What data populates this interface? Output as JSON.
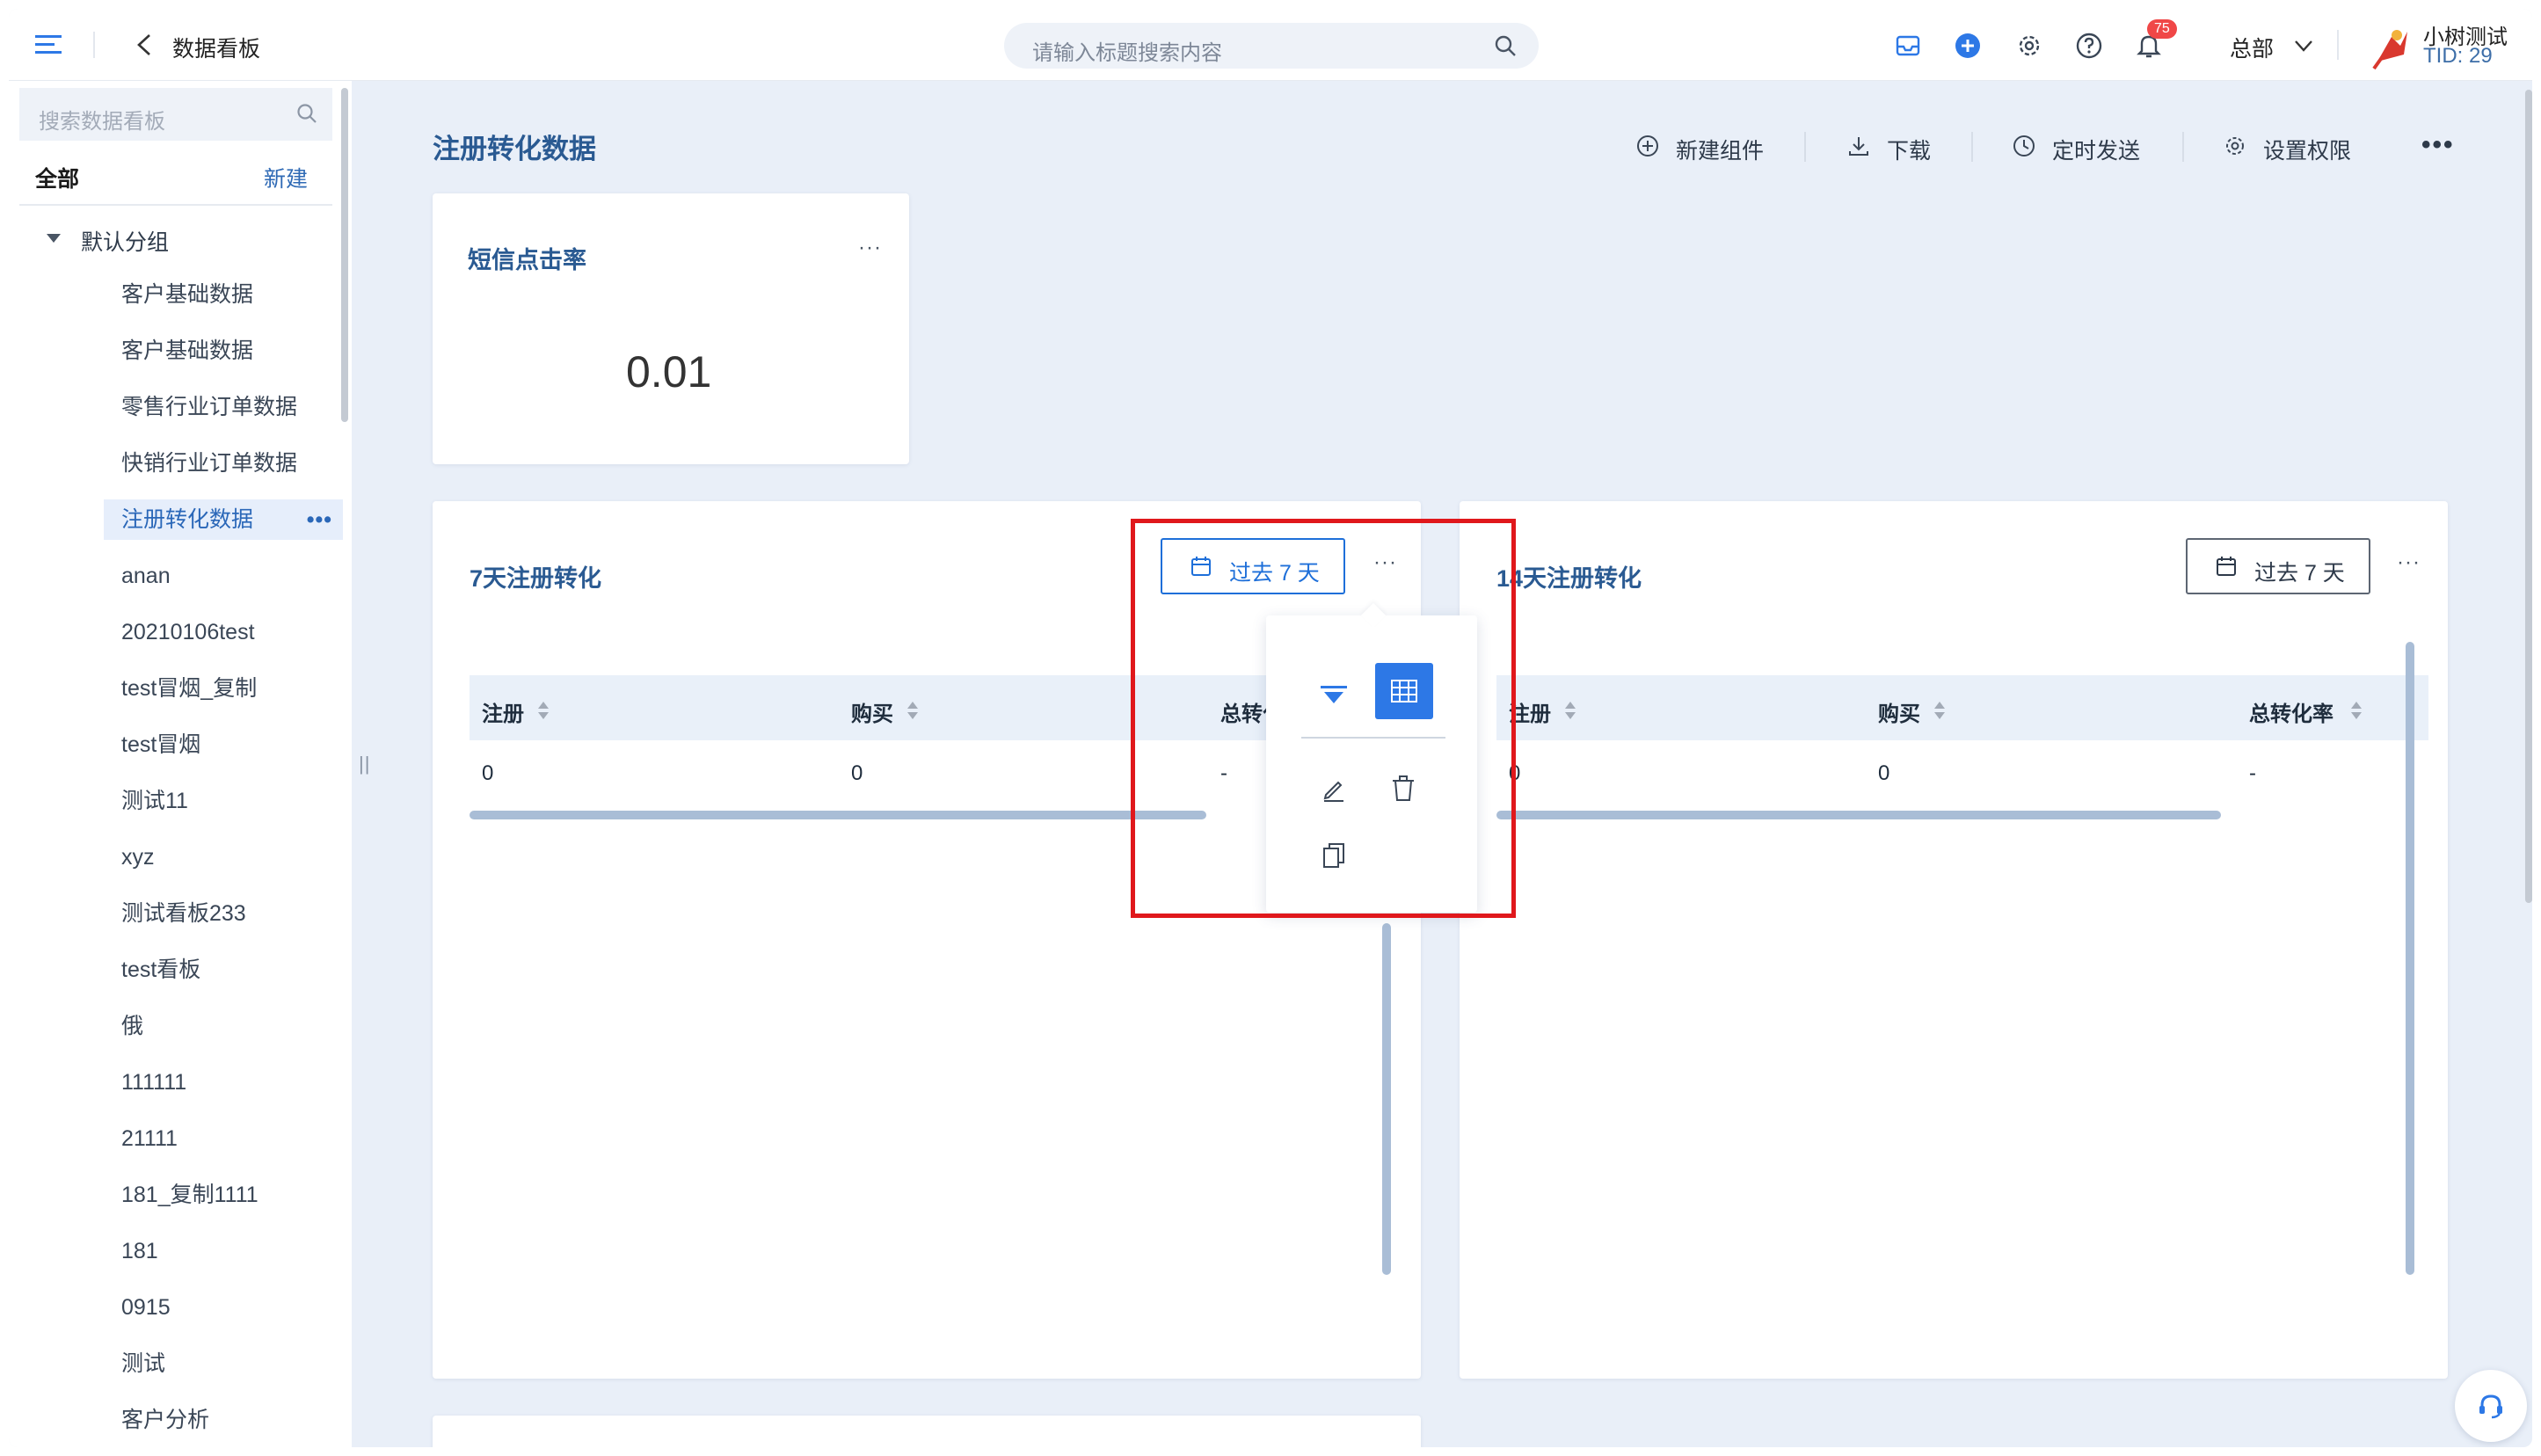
{
  "topbar": {
    "title": "数据看板",
    "search_placeholder": "请输入标题搜索内容",
    "notification_count": "75",
    "department": "总部",
    "user_name": "小树测试",
    "tid": "TID: 29"
  },
  "sidebar": {
    "search_placeholder": "搜索数据看板",
    "all_label": "全部",
    "new_label": "新建",
    "group_label": "默认分组",
    "items": [
      {
        "label": "客户基础数据"
      },
      {
        "label": "客户基础数据"
      },
      {
        "label": "零售行业订单数据"
      },
      {
        "label": "快销行业订单数据"
      },
      {
        "label": "注册转化数据",
        "active": true
      },
      {
        "label": "anan"
      },
      {
        "label": "20210106test"
      },
      {
        "label": "test冒烟_复制"
      },
      {
        "label": "test冒烟"
      },
      {
        "label": "测试11"
      },
      {
        "label": "xyz"
      },
      {
        "label": "测试看板233"
      },
      {
        "label": "test看板"
      },
      {
        "label": "俄"
      },
      {
        "label": "111111"
      },
      {
        "label": "21111"
      },
      {
        "label": "181_复制1111"
      },
      {
        "label": "181"
      },
      {
        "label": "0915"
      },
      {
        "label": "测试"
      },
      {
        "label": "客户分析"
      }
    ],
    "active_dots": "•••"
  },
  "main": {
    "page_title": "注册转化数据",
    "actions": {
      "new_component": "新建组件",
      "download": "下载",
      "schedule_send": "定时发送",
      "permissions": "设置权限",
      "more": "•••"
    },
    "kpi_card": {
      "title": "短信点击率",
      "value": "0.01",
      "more": "···"
    },
    "table_card_7": {
      "title": "7天注册转化",
      "date_label": "过去 7 天",
      "more": "···",
      "columns": [
        "注册",
        "购买",
        "总转化率"
      ],
      "rows": [
        [
          "0",
          "0",
          "-"
        ]
      ]
    },
    "table_card_14": {
      "title": "14天注册转化",
      "date_label": "过去 7 天",
      "more": "···",
      "columns": [
        "注册",
        "购买",
        "总转化率"
      ],
      "rows": [
        [
          "0",
          "0",
          "-"
        ]
      ]
    }
  },
  "colors": {
    "accent": "#2d78e6",
    "highlight": "#e0181c",
    "title_blue": "#2a5a92",
    "canvas_bg": "#e9eff8"
  }
}
